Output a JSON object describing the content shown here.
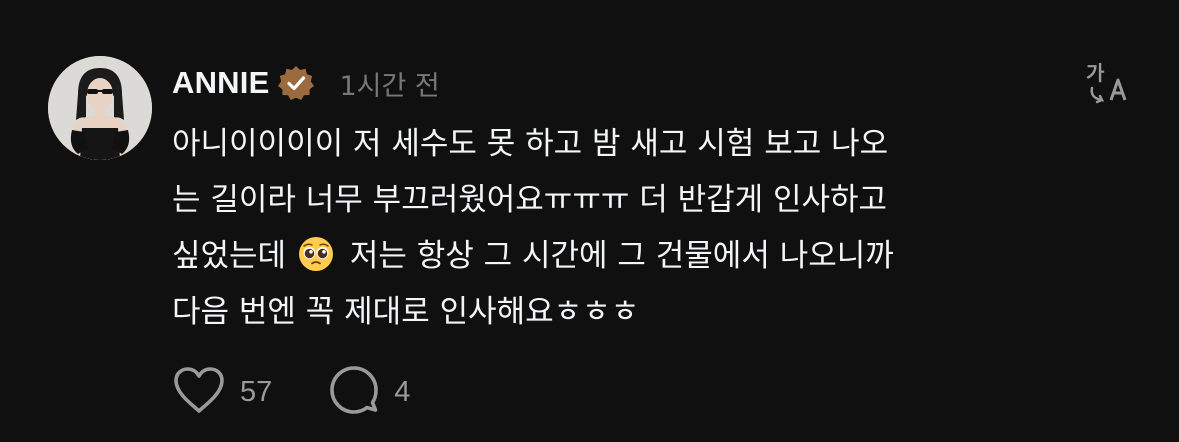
{
  "comment": {
    "username": "ANNIE",
    "timestamp": "1시간 전",
    "lines": [
      "아니이이이이 저 세수도 못 하고 밤 새고 시험 보고 나오",
      "는 길이라 너무 부끄러웠어요ㅠㅠㅠ 더 반갑게 인사하고",
      "싶었는데",
      "저는 항상 그 시간에 그 건물에서 나오니까",
      "다음 번엔 꼭 제대로 인사해요ㅎㅎㅎ"
    ],
    "emoji": "pleading-face-emoji",
    "likes": "57",
    "replies": "4"
  },
  "icons": {
    "verified": "verified-badge-icon",
    "translate": "translate-icon",
    "like": "heart-icon",
    "reply": "speech-bubble-icon"
  },
  "colors": {
    "background": "#101010",
    "text": "#f3f5f7",
    "muted": "#777777",
    "badge": "#9b6b3f"
  }
}
